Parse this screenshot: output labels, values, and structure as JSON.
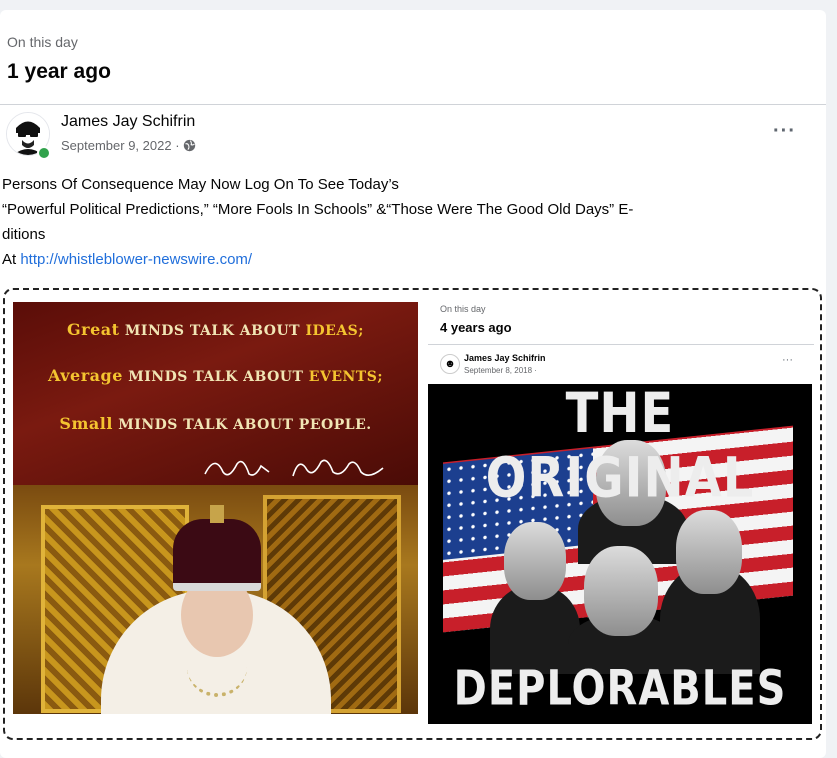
{
  "memory": {
    "section_label": "On this day",
    "time_ago": "1 year ago"
  },
  "post": {
    "author": "James Jay Schifrin",
    "date": "September 9, 2022 ·",
    "text_line1": "Persons Of Consequence May Now Log On To See Today’s",
    "text_line2": "“Powerful Political Predictions,” “More Fools In Schools” &“Those Were The Good Old Days” E-",
    "text_line3": "ditions",
    "text_line4_prefix": "At ",
    "link": "http://whistleblower-newswire.com/",
    "more_label": "···"
  },
  "left_image": {
    "quote_line1_hl": "Great",
    "quote_line1_rest": " minds talk about ",
    "quote_line1_hl2": "ideas;",
    "quote_line2_hl": "Average",
    "quote_line2_rest": " minds talk about ",
    "quote_line2_hl2": "events;",
    "quote_line3_hl": "Small",
    "quote_line3_rest": " minds talk about people.",
    "signature": "Eleanor Roosevelt"
  },
  "nested_post": {
    "section_label": "On this day",
    "time_ago": "4 years ago",
    "author": "James Jay Schifrin",
    "date": "September 8, 2018 ·",
    "more_label": "···",
    "poster_top": "THE ORIGINAL",
    "poster_bottom": "DEPLORABLES"
  },
  "icons": {
    "globe": "globe-icon",
    "more": "more-options-icon"
  },
  "colors": {
    "link": "#216fdb",
    "online": "#31a24c"
  }
}
